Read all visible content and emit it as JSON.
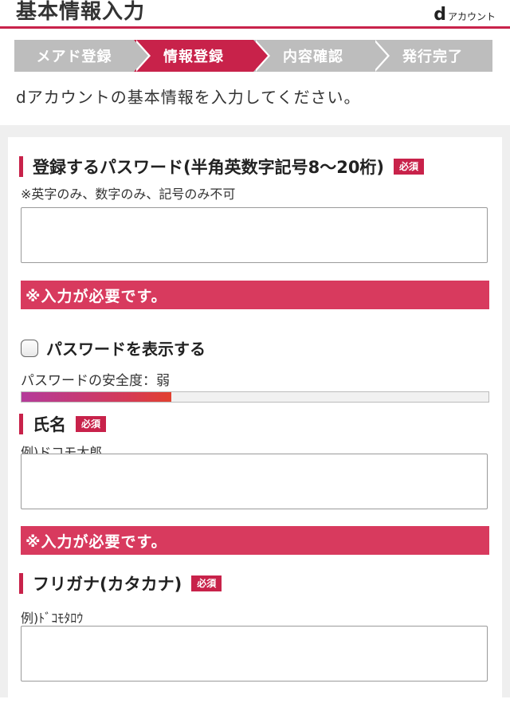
{
  "header": {
    "title": "基本情報入力",
    "brand_d": "d",
    "brand_text": "アカウント"
  },
  "steps": [
    {
      "label": "メアド登録",
      "active": false
    },
    {
      "label": "情報登録",
      "active": true
    },
    {
      "label": "内容確認",
      "active": false
    },
    {
      "label": "発行完了",
      "active": false
    }
  ],
  "intro": "dアカウントの基本情報を入力してください。",
  "password": {
    "label": "登録するパスワード(半角英数字記号8〜20桁)",
    "required_badge": "必須",
    "hint": "※英字のみ、数字のみ、記号のみ不可",
    "value": "",
    "error": "※入力が必要です。",
    "show_password_label": "パスワードを表示する",
    "strength_text": "パスワードの安全度：弱",
    "strength_fraction": 0.32
  },
  "name": {
    "label": "氏名",
    "required_badge": "必須",
    "hint": "例)ドコモ太郎",
    "value": "",
    "error": "※入力が必要です。"
  },
  "furigana": {
    "label": "フリガナ(カタカナ)",
    "required_badge": "必須",
    "hint": "例)ﾄﾞｺﾓﾀﾛｳ",
    "value": ""
  }
}
